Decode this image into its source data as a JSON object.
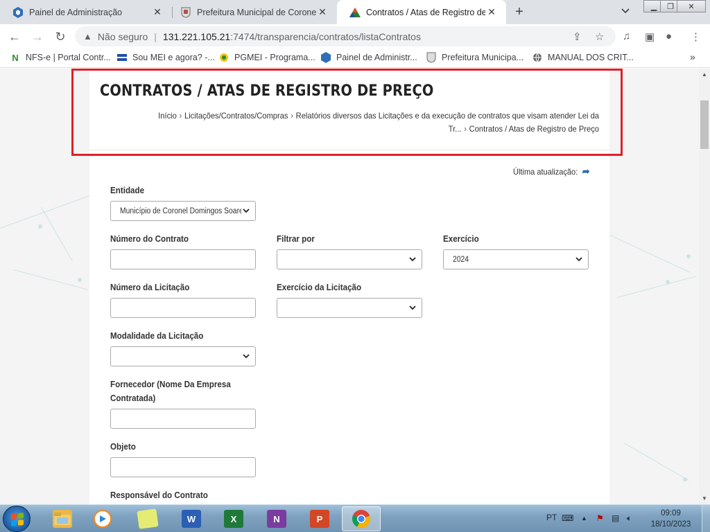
{
  "browser": {
    "tabs": [
      {
        "title": "Painel de Administração",
        "icon": "shield-hex-icon"
      },
      {
        "title": "Prefeitura Municipal de Coronel D",
        "icon": "crest-icon"
      },
      {
        "title": "Contratos / Atas de Registro de P",
        "icon": "triangle-logo-icon",
        "active": true
      }
    ],
    "new_tab": "+",
    "omnibox": {
      "security": "Não seguro",
      "host": "131.221.105.21",
      "path": ":7474/transparencia/contratos/listaContratos"
    },
    "bookmarks": [
      {
        "label": "NFS-e | Portal Contr...",
        "icon": "nfse-icon"
      },
      {
        "label": "Sou MEI e agora? -...",
        "icon": "flag-icon"
      },
      {
        "label": "PGMEI - Programa...",
        "icon": "pgmei-icon"
      },
      {
        "label": "Painel de Administr...",
        "icon": "shield-hex-icon"
      },
      {
        "label": "Prefeitura Municipa...",
        "icon": "crest-icon"
      },
      {
        "label": "MANUAL DOS CRIT...",
        "icon": "globe-icon"
      }
    ],
    "bookmarks_more": "»"
  },
  "page": {
    "title": "CONTRATOS / ATAS DE REGISTRO DE PREÇO",
    "breadcrumb": [
      "Início",
      "Licitações/Contratos/Compras",
      "Relatórios diversos das Licitações e da execução de contratos que visam atender Lei da Tr...",
      "Contratos / Atas de Registro de Preço"
    ],
    "last_update_label": "Última atualização:",
    "form": {
      "entidade": {
        "label": "Entidade",
        "value": "Município de Coronel Domingos Soares"
      },
      "numero_contrato": {
        "label": "Número do Contrato",
        "value": ""
      },
      "filtrar_por": {
        "label": "Filtrar por",
        "value": ""
      },
      "exercicio": {
        "label": "Exercício",
        "value": "2024"
      },
      "numero_licitacao": {
        "label": "Número da Licitação",
        "value": ""
      },
      "exercicio_licitacao": {
        "label": "Exercício da Licitação",
        "value": ""
      },
      "modalidade": {
        "label": "Modalidade da Licitação",
        "value": ""
      },
      "fornecedor": {
        "label_line1": "Fornecedor (Nome Da Empresa",
        "label_line2": "Contratada)",
        "value": ""
      },
      "objeto": {
        "label": "Objeto",
        "value": ""
      },
      "responsavel": {
        "label": "Responsável do Contrato"
      }
    }
  },
  "taskbar": {
    "apps": [
      {
        "name": "explorer",
        "icon": "folder-icon",
        "color": "#e8b84a"
      },
      {
        "name": "media-player",
        "icon": "media-player-icon",
        "color": "#f08a1c"
      },
      {
        "name": "sticky-notes",
        "icon": "sticky-notes-icon",
        "color": "#d8e25a"
      },
      {
        "name": "word",
        "icon": "word-icon",
        "color": "#2b5fb4",
        "glyph": "W"
      },
      {
        "name": "excel",
        "icon": "excel-icon",
        "color": "#1f7a3a",
        "glyph": "X"
      },
      {
        "name": "onenote",
        "icon": "onenote-icon",
        "color": "#7a3ca0",
        "glyph": "N"
      },
      {
        "name": "powerpoint",
        "icon": "powerpoint-icon",
        "color": "#d24726",
        "glyph": "P"
      },
      {
        "name": "chrome",
        "icon": "chrome-icon",
        "color": "#ffffff",
        "active": true
      }
    ],
    "language": "PT",
    "time": "09:09",
    "date": "18/10/2023"
  },
  "colors": {
    "highlight": "#e01f26",
    "page_bg": "#f4f4f4",
    "link_blue": "#2b6cb0"
  }
}
